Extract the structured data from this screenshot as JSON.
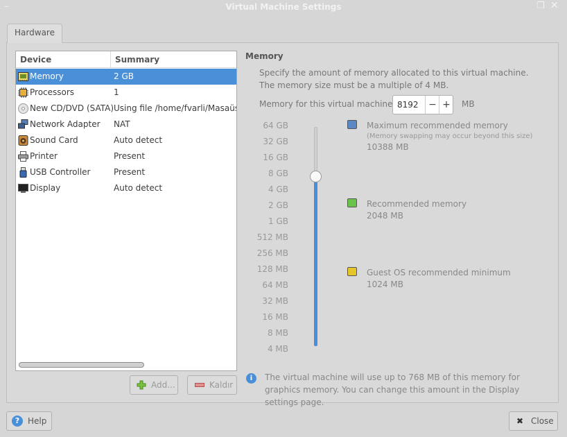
{
  "window": {
    "title": "Virtual Machine Settings",
    "menu_glyph": "–",
    "max_glyph": "❐",
    "close_glyph": "✕"
  },
  "tabs": [
    {
      "label": "Hardware",
      "active": true
    }
  ],
  "device_table": {
    "headers": {
      "device": "Device",
      "summary": "Summary"
    },
    "rows": [
      {
        "device": "Memory",
        "summary": "2 GB",
        "icon": "memory-icon",
        "selected": true
      },
      {
        "device": "Processors",
        "summary": "1",
        "icon": "processor-icon"
      },
      {
        "device": "New CD/DVD (SATA)",
        "summary": "Using file /home/fvarli/Masaüstü",
        "icon": "cd-icon"
      },
      {
        "device": "Network Adapter",
        "summary": "NAT",
        "icon": "network-icon"
      },
      {
        "device": "Sound Card",
        "summary": "Auto detect",
        "icon": "speaker-icon"
      },
      {
        "device": "Printer",
        "summary": "Present",
        "icon": "printer-icon"
      },
      {
        "device": "USB Controller",
        "summary": "Present",
        "icon": "usb-icon"
      },
      {
        "device": "Display",
        "summary": "Auto detect",
        "icon": "display-icon"
      }
    ]
  },
  "buttons": {
    "add": "Add...",
    "remove": "Kaldır",
    "help": "Help",
    "close": "Close"
  },
  "memory": {
    "section_title": "Memory",
    "description": "Specify the amount of memory allocated to this virtual machine. The memory size must be a multiple of 4 MB.",
    "field_label": "Memory for this virtual machine:",
    "value": "8192",
    "minus": "−",
    "plus": "+",
    "unit": "MB",
    "scale": [
      "64 GB",
      "32 GB",
      "16 GB",
      "8 GB",
      "4 GB",
      "2 GB",
      "1 GB",
      "512 MB",
      "256 MB",
      "128 MB",
      "64 MB",
      "32 MB",
      "16 MB",
      "8 MB",
      "4 MB"
    ],
    "slider_value": "8 GB",
    "legend": {
      "max": {
        "label": "Maximum recommended memory",
        "note": "(Memory swapping may occur beyond this size)",
        "value": "10388 MB",
        "color": "#5b87c5"
      },
      "rec": {
        "label": "Recommended memory",
        "value": "2048 MB",
        "color": "#6ac34a"
      },
      "min": {
        "label": "Guest OS recommended minimum",
        "value": "1024 MB",
        "color": "#e6c628"
      }
    },
    "info": "The virtual machine will use up to 768 MB of this memory for graphics memory. You can change this amount in the Display settings page."
  },
  "colors": {
    "accent": "#4a90d9",
    "window_bg": "#d6d6d6"
  }
}
